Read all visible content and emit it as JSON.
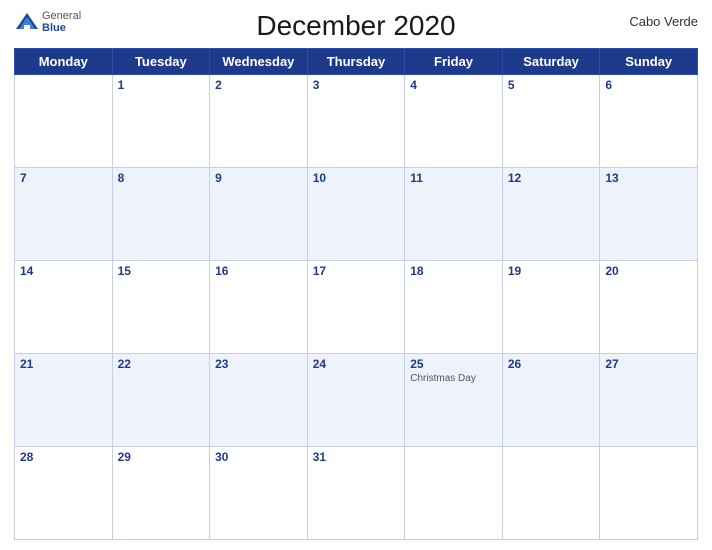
{
  "header": {
    "logo": {
      "general": "General",
      "blue": "Blue",
      "icon_color": "#1a4a9c"
    },
    "title": "December 2020",
    "country": "Cabo Verde"
  },
  "days_of_week": [
    "Monday",
    "Tuesday",
    "Wednesday",
    "Thursday",
    "Friday",
    "Saturday",
    "Sunday"
  ],
  "weeks": [
    [
      {
        "day": "",
        "empty": true
      },
      {
        "day": "1"
      },
      {
        "day": "2"
      },
      {
        "day": "3"
      },
      {
        "day": "4"
      },
      {
        "day": "5"
      },
      {
        "day": "6"
      }
    ],
    [
      {
        "day": "7"
      },
      {
        "day": "8"
      },
      {
        "day": "9"
      },
      {
        "day": "10"
      },
      {
        "day": "11"
      },
      {
        "day": "12"
      },
      {
        "day": "13"
      }
    ],
    [
      {
        "day": "14"
      },
      {
        "day": "15"
      },
      {
        "day": "16"
      },
      {
        "day": "17"
      },
      {
        "day": "18"
      },
      {
        "day": "19"
      },
      {
        "day": "20"
      }
    ],
    [
      {
        "day": "21"
      },
      {
        "day": "22"
      },
      {
        "day": "23"
      },
      {
        "day": "24"
      },
      {
        "day": "25",
        "holiday": "Christmas Day"
      },
      {
        "day": "26"
      },
      {
        "day": "27"
      }
    ],
    [
      {
        "day": "28"
      },
      {
        "day": "29"
      },
      {
        "day": "30"
      },
      {
        "day": "31"
      },
      {
        "day": ""
      },
      {
        "day": ""
      },
      {
        "day": ""
      }
    ]
  ],
  "row_classes": [
    "row-odd",
    "row-even",
    "row-odd",
    "row-even",
    "row-odd"
  ]
}
